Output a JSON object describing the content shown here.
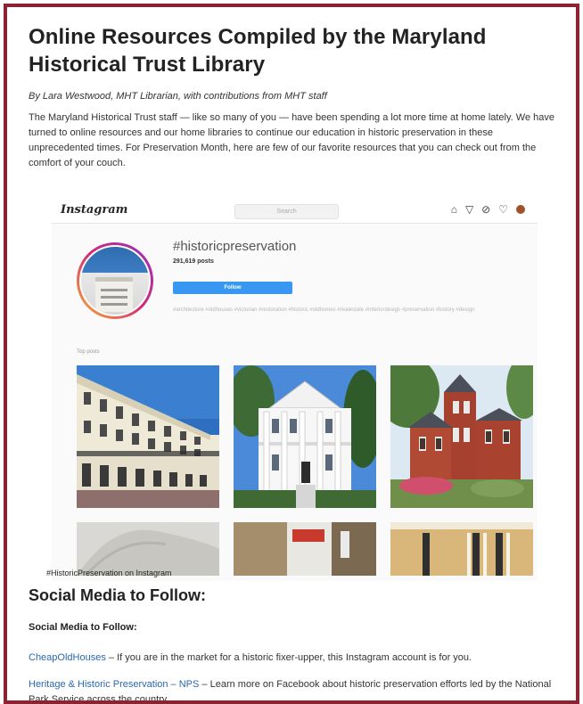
{
  "article": {
    "title": "Online Resources Compiled by the Maryland Historical Trust Library",
    "byline": "By Lara Westwood, MHT Librarian, with contributions from MHT staff",
    "intro": "The Maryland Historical Trust staff — like so many of you — have been spending a lot more time at home lately. We have turned to online resources and our home libraries to continue our education in historic preservation in these unprecedented times. For Preservation Month, here are few of our favorite resources that you can check out from the comfort of your couch."
  },
  "instagram": {
    "logo": "Instagram",
    "search_placeholder": "Search",
    "icons": [
      "home-icon",
      "explore-icon",
      "compass-icon",
      "heart-icon",
      "profile-icon"
    ],
    "hashtag": "#historicpreservation",
    "posts_count": "291,619 posts",
    "follow_label": "Follow",
    "related": "#architecture #oldhouses #victorian #restoration #historic #oldhomes #realestate #interiordesign #preservation #history #design",
    "top_posts_label": "Top posts",
    "caption": "#HistoricPreservation on Instagram"
  },
  "social": {
    "heading": "Social Media to Follow:",
    "subheading": "Social Media to Follow:",
    "items": [
      {
        "link": "CheapOldHouses",
        "text": " – If you are in the market for a historic fixer-upper, this Instagram account is for you."
      },
      {
        "link": "Heritage & Historic Preservation – NPS",
        "text": " – Learn more on Facebook about historic preservation efforts led by the National Park Service across the country."
      }
    ]
  },
  "colors": {
    "frame": "#8b2332",
    "link": "#2a67b1",
    "follow": "#3897f0"
  }
}
